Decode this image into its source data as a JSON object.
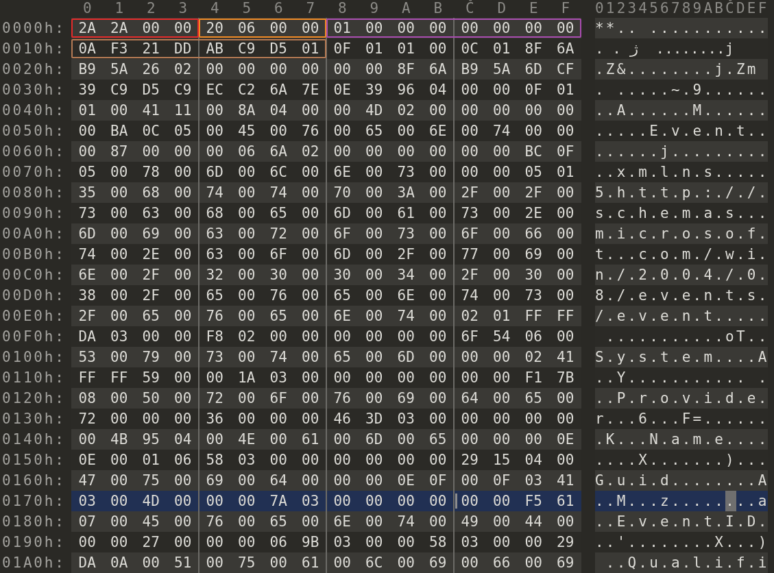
{
  "header": {
    "columns": [
      "0",
      "1",
      "2",
      "3",
      "4",
      "5",
      "6",
      "7",
      "8",
      "9",
      "A",
      "B",
      "Č",
      "D",
      "E",
      "F"
    ],
    "ascii": "0123456789ABČDEF"
  },
  "rows": [
    {
      "offset": "0000h:",
      "selected": false,
      "hex": [
        {
          "bytes": "2A 2A 00 00",
          "color": "#e42a2a"
        },
        {
          "bytes": "20 06 00 00",
          "color": "#f08a24"
        },
        {
          "bytes": "01 00 00 00 00 00 00 00",
          "color": "#a94cb0"
        }
      ],
      "ascii": [
        {
          "text": "**.. ...........",
          "cursor": false
        }
      ]
    },
    {
      "offset": "0010h:",
      "selected": false,
      "hex": [
        {
          "bytes": "0A F3 21 DD AB C9 D5 01",
          "color": "#b57a54"
        },
        {
          "bytes": "0F 01 01 00 0C 01 8F 6A"
        }
      ],
      "ascii": [
        {
          "text": ". . ژ  ........j",
          "cursor": false
        }
      ]
    },
    {
      "offset": "0020h:",
      "selected": false,
      "hex": [
        {
          "bytes": "B9 5A 26 02 00 00 00 00 00 00 8F 6A B9 5A 6D CF"
        }
      ],
      "ascii": [
        {
          "text": ".Z&........j.Zm ",
          "cursor": false
        }
      ]
    },
    {
      "offset": "0030h:",
      "selected": false,
      "hex": [
        {
          "bytes": "39 C9 D5 C9 EC C2 6A 7E 0E 39 96 04 00 00 0F 01"
        }
      ],
      "ascii": [
        {
          "text": ". .....~.9......",
          "cursor": false
        }
      ]
    },
    {
      "offset": "0040h:",
      "selected": false,
      "hex": [
        {
          "bytes": "01 00 41 11 00 8A 04 00 00 4D 02 00 00 00 00 00"
        }
      ],
      "ascii": [
        {
          "text": "..A......M......",
          "cursor": false
        }
      ]
    },
    {
      "offset": "0050h:",
      "selected": false,
      "hex": [
        {
          "bytes": "00 BA 0C 05 00 45 00 76 00 65 00 6E 00 74 00 00"
        }
      ],
      "ascii": [
        {
          "text": ".....E.v.e.n.t..",
          "cursor": false
        }
      ]
    },
    {
      "offset": "0060h:",
      "selected": false,
      "hex": [
        {
          "bytes": "00 87 00 00 00 06 6A 02 00 00 00 00 00 00 BC 0F"
        }
      ],
      "ascii": [
        {
          "text": "......j.........",
          "cursor": false
        }
      ]
    },
    {
      "offset": "0070h:",
      "selected": false,
      "hex": [
        {
          "bytes": "05 00 78 00 6D 00 6C 00 6E 00 73 00 00 00 05 01"
        }
      ],
      "ascii": [
        {
          "text": "..x.m.l.n.s.....",
          "cursor": false
        }
      ]
    },
    {
      "offset": "0080h:",
      "selected": false,
      "hex": [
        {
          "bytes": "35 00 68 00 74 00 74 00 70 00 3A 00 2F 00 2F 00"
        }
      ],
      "ascii": [
        {
          "text": "5.h.t.t.p.:././.",
          "cursor": false
        }
      ]
    },
    {
      "offset": "0090h:",
      "selected": false,
      "hex": [
        {
          "bytes": "73 00 63 00 68 00 65 00 6D 00 61 00 73 00 2E 00"
        }
      ],
      "ascii": [
        {
          "text": "s.c.h.e.m.a.s...",
          "cursor": false
        }
      ]
    },
    {
      "offset": "00A0h:",
      "selected": false,
      "hex": [
        {
          "bytes": "6D 00 69 00 63 00 72 00 6F 00 73 00 6F 00 66 00"
        }
      ],
      "ascii": [
        {
          "text": "m.i.c.r.o.s.o.f.",
          "cursor": false
        }
      ]
    },
    {
      "offset": "00B0h:",
      "selected": false,
      "hex": [
        {
          "bytes": "74 00 2E 00 63 00 6F 00 6D 00 2F 00 77 00 69 00"
        }
      ],
      "ascii": [
        {
          "text": "t...c.o.m./.w.i.",
          "cursor": false
        }
      ]
    },
    {
      "offset": "00C0h:",
      "selected": false,
      "hex": [
        {
          "bytes": "6E 00 2F 00 32 00 30 00 30 00 34 00 2F 00 30 00"
        }
      ],
      "ascii": [
        {
          "text": "n./.2.0.0.4./.0.",
          "cursor": false
        }
      ]
    },
    {
      "offset": "00D0h:",
      "selected": false,
      "hex": [
        {
          "bytes": "38 00 2F 00 65 00 76 00 65 00 6E 00 74 00 73 00"
        }
      ],
      "ascii": [
        {
          "text": "8./.e.v.e.n.t.s.",
          "cursor": false
        }
      ]
    },
    {
      "offset": "00E0h:",
      "selected": false,
      "hex": [
        {
          "bytes": "2F 00 65 00 76 00 65 00 6E 00 74 00 02 01 FF FF"
        }
      ],
      "ascii": [
        {
          "text": "/.e.v.e.n.t.....",
          "cursor": false
        }
      ]
    },
    {
      "offset": "00F0h:",
      "selected": false,
      "hex": [
        {
          "bytes": "DA 03 00 00 F8 02 00 00 00 00 00 00 6F 54 06 00"
        }
      ],
      "ascii": [
        {
          "text": " ...........oT..",
          "cursor": false
        }
      ]
    },
    {
      "offset": "0100h:",
      "selected": false,
      "hex": [
        {
          "bytes": "53 00 79 00 73 00 74 00 65 00 6D 00 00 00 02 41"
        }
      ],
      "ascii": [
        {
          "text": "S.y.s.t.e.m....A",
          "cursor": false
        }
      ]
    },
    {
      "offset": "0110h:",
      "selected": false,
      "hex": [
        {
          "bytes": "FF FF 59 00 00 1A 03 00 00 00 00 00 00 00 F1 7B"
        }
      ],
      "ascii": [
        {
          "text": "..Y........... .",
          "cursor": false
        }
      ]
    },
    {
      "offset": "0120h:",
      "selected": false,
      "hex": [
        {
          "bytes": "08 00 50 00 72 00 6F 00 76 00 69 00 64 00 65 00"
        }
      ],
      "ascii": [
        {
          "text": "..P.r.o.v.i.d.e.",
          "cursor": false
        }
      ]
    },
    {
      "offset": "0130h:",
      "selected": false,
      "hex": [
        {
          "bytes": "72 00 00 00 36 00 00 00 46 3D 03 00 00 00 00 00"
        }
      ],
      "ascii": [
        {
          "text": "r...6...F=......",
          "cursor": false
        }
      ]
    },
    {
      "offset": "0140h:",
      "selected": false,
      "hex": [
        {
          "bytes": "00 4B 95 04 00 4E 00 61 00 6D 00 65 00 00 00 0E"
        }
      ],
      "ascii": [
        {
          "text": ".K...N.a.m.e....",
          "cursor": false
        }
      ]
    },
    {
      "offset": "0150h:",
      "selected": false,
      "hex": [
        {
          "bytes": "0E 00 01 06 58 03 00 00 00 00 00 00 29 15 04 00"
        }
      ],
      "ascii": [
        {
          "text": "....X.......)...",
          "cursor": false
        }
      ]
    },
    {
      "offset": "0160h:",
      "selected": false,
      "hex": [
        {
          "bytes": "47 00 75 00 69 00 64 00 00 00 0E 0F 00 0F 03 41"
        }
      ],
      "ascii": [
        {
          "text": "G.u.i.d........A",
          "cursor": false
        }
      ]
    },
    {
      "offset": "0170h:",
      "selected": true,
      "hex": [
        {
          "bytes": "03 00 4D 00 00 00 7A 03 00 00 00 00"
        },
        {
          "bytes": "00 00 F5 61",
          "cursor": true
        }
      ],
      "ascii": [
        {
          "text": "..M...z.....",
          "cursor": false
        },
        {
          "text": ".",
          "cursor": true
        },
        {
          "text": "..a",
          "cursor": false
        }
      ]
    },
    {
      "offset": "0180h:",
      "selected": false,
      "hex": [
        {
          "bytes": "07 00 45 00 76 00 65 00 6E 00 74 00 49 00 44 00"
        }
      ],
      "ascii": [
        {
          "text": "..E.v.e.n.t.I.D.",
          "cursor": false
        }
      ]
    },
    {
      "offset": "0190h:",
      "selected": false,
      "hex": [
        {
          "bytes": "00 00 27 00 00 00 06 9B 03 00 00 58 03 00 00 29"
        }
      ],
      "ascii": [
        {
          "text": "..'........X...)",
          "cursor": false
        }
      ]
    },
    {
      "offset": "01A0h:",
      "selected": false,
      "hex": [
        {
          "bytes": "DA 0A 00 51 00 75 00 61 00 6C 00 69 00 66 00 69"
        }
      ],
      "ascii": [
        {
          "text": " ..Q.u.a.l.i.f.i",
          "cursor": false
        }
      ]
    }
  ]
}
